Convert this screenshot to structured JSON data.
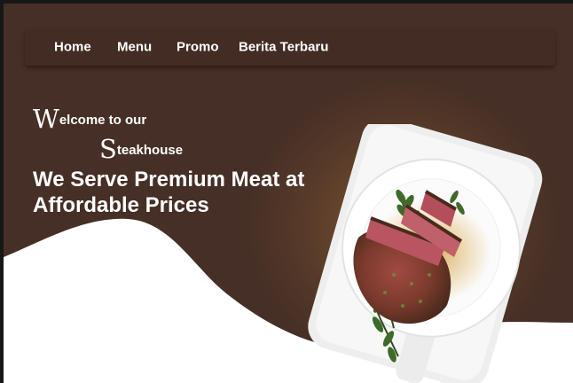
{
  "nav": {
    "items": [
      "Home",
      "Menu",
      "Promo",
      "Berita Terbaru"
    ]
  },
  "hero": {
    "welcome_initial": "W",
    "welcome_rest": "elcome to our",
    "steak_initial": "S",
    "steak_rest": "teakhouse",
    "headline_line1": "We Serve Premium Meat at",
    "headline_line2": "Affordable Prices"
  },
  "colors": {
    "background": "#462f26",
    "navbar": "#432c24",
    "wave": "#ffffff",
    "glow": "#f6a54a",
    "text": "#ffffff"
  },
  "image": {
    "subject": "grilled steak slices with rosemary on a white plate"
  }
}
